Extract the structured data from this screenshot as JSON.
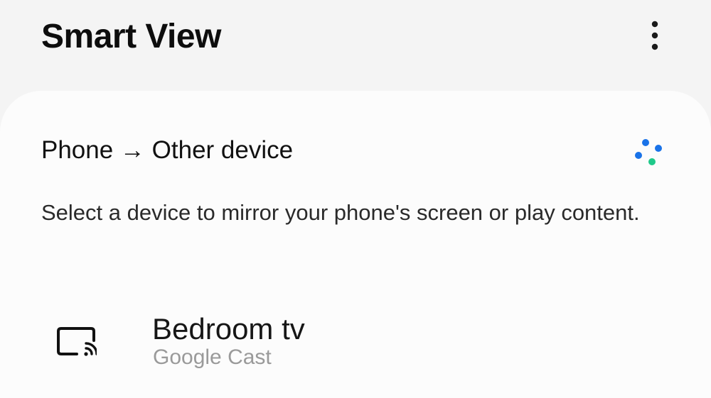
{
  "header": {
    "title": "Smart View",
    "more_icon": "more-vertical-icon"
  },
  "mirror": {
    "section_title": "Phone → Other device",
    "scan_icon": "scanning-dots-icon",
    "description": "Select a device to mirror your phone's screen or play content."
  },
  "devices": [
    {
      "name": "Bedroom tv",
      "type": "Google Cast",
      "icon": "cast-screen-icon"
    }
  ],
  "colors": {
    "background": "#f4f4f4",
    "card": "#fcfcfc",
    "scan_blue": "#1a73e8",
    "scan_green": "#1fc98a",
    "secondary_text": "#9a9a9a"
  }
}
